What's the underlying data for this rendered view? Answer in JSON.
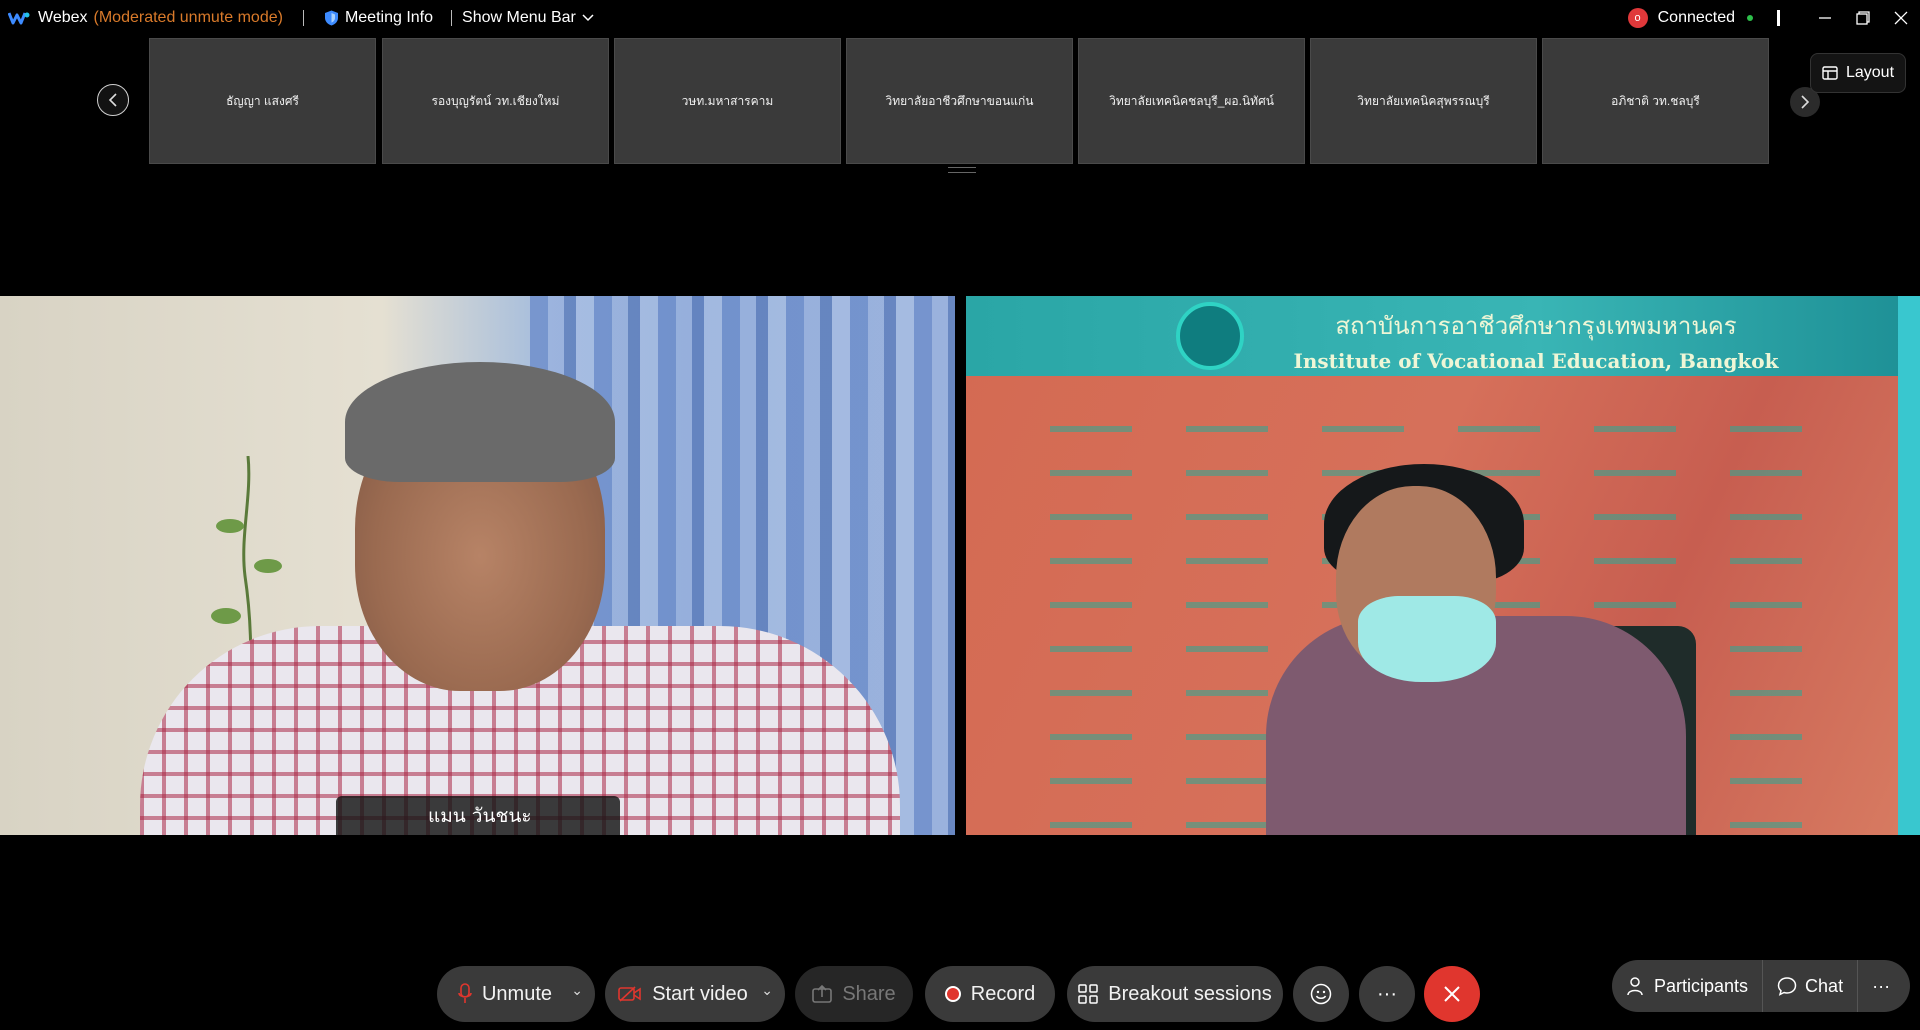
{
  "titlebar": {
    "app_name": "Webex",
    "mode": "(Moderated unmute mode)",
    "meeting_info": "Meeting Info",
    "show_menu_bar": "Show Menu Bar",
    "connection_badge": "o",
    "connection_status": "Connected"
  },
  "strip": {
    "thumbnails": [
      "ธัญญา แสงศรี",
      "รองบุญรัตน์ วท.เชียงใหม่",
      "วษท.มหาสารคาม",
      "วิทยาลัยอาชีวศึกษาขอนแก่น",
      "วิทยาลัยเทคนิคชลบุรี_ผอ.นิทัศน์",
      "วิทยาลัยเทคนิคสุพรรณบุรี",
      "อภิชาติ วท.ชลบุรี"
    ],
    "layout_label": "Layout"
  },
  "videos": {
    "left_name": "แมน วันชนะ",
    "right_org_th": "สถาบันการอาชีวศึกษากรุงเทพมหานคร",
    "right_org_en": "Institute of Vocational Education, Bangkok"
  },
  "controls": {
    "unmute": "Unmute",
    "start_video": "Start video",
    "share": "Share",
    "record": "Record",
    "breakout": "Breakout sessions",
    "more": "···",
    "participants": "Participants",
    "chat": "Chat",
    "right_more": "···"
  },
  "colors": {
    "accent_mode": "#d97a2a",
    "end_call": "#e0362e",
    "connected_dot": "#2dbf4a"
  }
}
